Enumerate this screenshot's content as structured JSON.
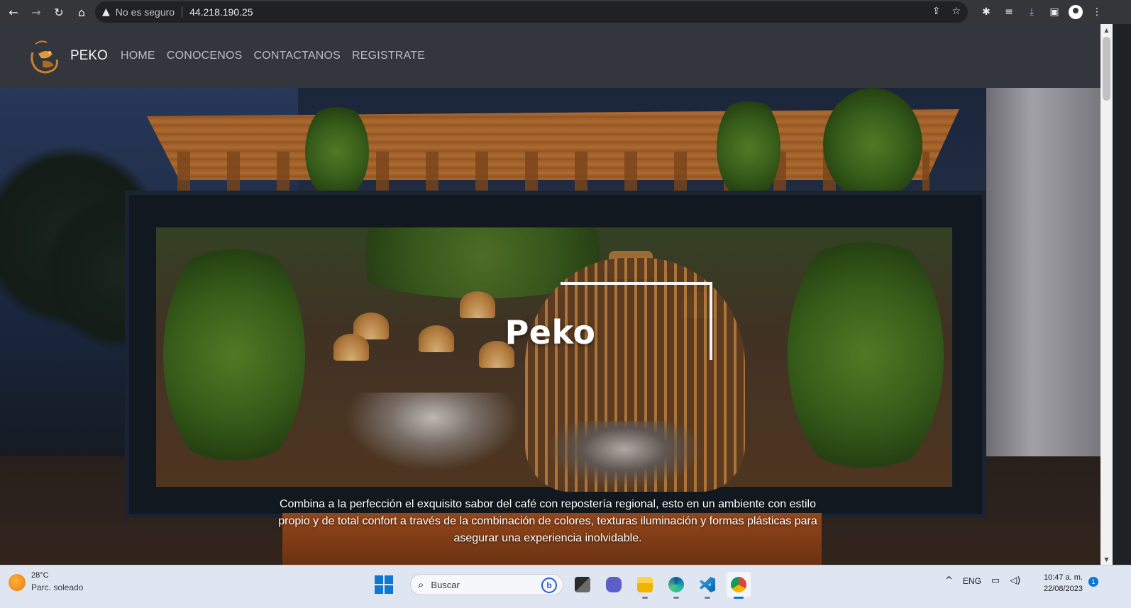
{
  "browser": {
    "security_text": "No es seguro",
    "url": "44.218.190.25",
    "back_icon": "←",
    "forward_icon": "→",
    "reload_icon": "↻",
    "home_icon": "⌂",
    "warning_icon": "▲",
    "share_icon": "⇪",
    "star_icon": "☆",
    "extensions_icon": "✱",
    "media_icon": "≡",
    "download_icon": "⤓",
    "sidepanel_icon": "▣",
    "menu_icon": "⋮"
  },
  "site": {
    "brand": "PEKO",
    "menu": [
      "HOME",
      "CONOCENOS",
      "CONTACTANOS",
      "REGISTRATE"
    ],
    "hero_title": "Peko",
    "hero_text": "Combina a la perfección el exquisito sabor del café con repostería regional, esto en un ambiente con estilo propio y de total confort a través de la combinación de colores, texturas iluminación y formas plásticas para asegurar una experiencia inolvidable.",
    "accent_color": "#c9822c"
  },
  "scrollbar": {
    "up": "▲",
    "down": "▼"
  },
  "taskbar": {
    "temperature": "28°C",
    "condition": "Parc. soleado",
    "search_placeholder": "Buscar",
    "search_icon": "⌕",
    "bing_label": "b",
    "tray_chevron": "^",
    "language": "ENG",
    "network_icon": "▭",
    "volume_icon": "◁)",
    "time": "10:47 a. m.",
    "date": "22/08/2023",
    "notification_count": "1"
  }
}
